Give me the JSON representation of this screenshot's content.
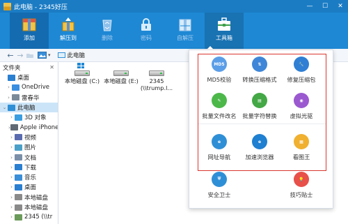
{
  "window": {
    "title": "此电脑 - 2345好压",
    "min": "—",
    "max": "☐",
    "close": "✕"
  },
  "toolbar": {
    "tools": [
      {
        "label": "添加",
        "icon": "add-archive-icon"
      },
      {
        "label": "解压到",
        "icon": "extract-to-icon"
      },
      {
        "label": "删除",
        "icon": "recycle-bin-icon"
      },
      {
        "label": "密码",
        "icon": "lock-icon"
      },
      {
        "label": "自解压",
        "icon": "self-extract-icon"
      },
      {
        "label": "工具箱",
        "icon": "toolbox-icon"
      }
    ]
  },
  "addressbar": {
    "back": "←",
    "forward": "→",
    "dropdown": "▾",
    "path": "此电脑"
  },
  "sidebar": {
    "header": "文件夹",
    "close": "✕",
    "items": [
      {
        "label": "桌面",
        "arrow": "",
        "color": "#2a7fd0"
      },
      {
        "label": "OneDrive",
        "arrow": "›",
        "color": "#3a8fe0"
      },
      {
        "label": "雷春华",
        "arrow": "›",
        "color": "#7b8a99"
      },
      {
        "label": "此电脑",
        "arrow": "⌄",
        "color": "#2f8fd6"
      },
      {
        "label": "3D 对象",
        "arrow": "›",
        "color": "#3a9ee0"
      },
      {
        "label": "Apple iPhone",
        "arrow": "›",
        "color": "#606a74"
      },
      {
        "label": "视频",
        "arrow": "›",
        "color": "#5a6bb0"
      },
      {
        "label": "图片",
        "arrow": "›",
        "color": "#4aa0c8"
      },
      {
        "label": "文档",
        "arrow": "›",
        "color": "#7b8fa8"
      },
      {
        "label": "下载",
        "arrow": "›",
        "color": "#2a7fd0"
      },
      {
        "label": "音乐",
        "arrow": "›",
        "color": "#3a8fd8"
      },
      {
        "label": "桌面",
        "arrow": "›",
        "color": "#2a7fd0"
      },
      {
        "label": "本地磁盘",
        "arrow": "›",
        "color": "#8a8a8a"
      },
      {
        "label": "本地磁盘",
        "arrow": "›",
        "color": "#8a8a8a"
      },
      {
        "label": "2345 (\\\\tr",
        "arrow": "›",
        "color": "#6b9a5a"
      }
    ]
  },
  "drives": [
    {
      "label": "本地磁盘 (C:)",
      "label2": "",
      "type": "system"
    },
    {
      "label": "本地磁盘 (E:)",
      "label2": "",
      "type": "disk"
    },
    {
      "label": "2345",
      "label2": "(\\\\trump.l...",
      "type": "network"
    }
  ],
  "toolpanel": {
    "tools": [
      {
        "label": "MD5校验",
        "icon": "md5-icon",
        "glyph": "MD5",
        "color": "#5b9ee8"
      },
      {
        "label": "转换压缩格式",
        "icon": "convert-format-icon",
        "glyph": "⇅",
        "color": "#3e86d8"
      },
      {
        "label": "修复压缩包",
        "icon": "wrench-icon",
        "glyph": "🔧",
        "color": "#2f7fd4"
      },
      {
        "label": "批量文件改名",
        "icon": "rename-icon",
        "glyph": "✎",
        "color": "#4cb84a"
      },
      {
        "label": "批量字符替换",
        "icon": "replace-text-icon",
        "glyph": "▤",
        "color": "#43a845"
      },
      {
        "label": "虚拟光驱",
        "icon": "disc-icon",
        "glyph": "◉",
        "color": "#9b59d0"
      },
      {
        "label": "网址导航",
        "icon": "browser-e-icon",
        "glyph": "e",
        "color": "#2f8fd6"
      },
      {
        "label": "加速浏览器",
        "icon": "speed-browser-icon",
        "glyph": "e",
        "color": "#1f7fd0"
      },
      {
        "label": "看图王",
        "icon": "image-viewer-icon",
        "glyph": "▦",
        "color": "#f0b030"
      },
      {
        "label": "安全卫士",
        "icon": "shield-icon",
        "glyph": "⛨",
        "color": "#2f8fd6"
      },
      {
        "label": "技巧贴士",
        "icon": "lightbulb-icon",
        "glyph": "💡",
        "color": "#e8504a"
      }
    ]
  },
  "colors": {
    "titlebar": "#1b7cc4",
    "toolbar": "#1e88d4",
    "highlight": "#d9362f"
  }
}
